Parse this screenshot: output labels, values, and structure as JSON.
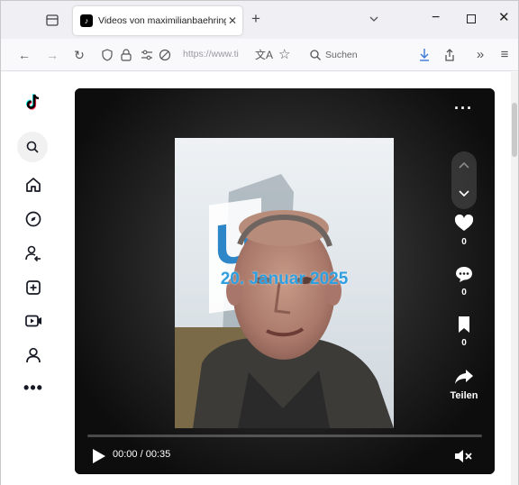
{
  "tab": {
    "title": "Videos von maximilianbaehring"
  },
  "nav": {
    "url": "https://www.ti",
    "search_placeholder": "Suchen"
  },
  "video": {
    "overlay_text": "20. Januar 2025",
    "likes": "0",
    "comments": "0",
    "saves": "0",
    "share_label": "Teilen",
    "time": "00:00 / 00:35",
    "progress": 0
  },
  "icons": {
    "logo": "tiktok-logo",
    "sidebar": [
      "search-icon",
      "home-icon",
      "explore-icon",
      "following-icon",
      "upload-icon",
      "live-icon",
      "profile-icon",
      "more-icon"
    ]
  },
  "colors": {
    "overlay_text": "#2f9fe0",
    "video_bg": "#0b0b0b"
  }
}
